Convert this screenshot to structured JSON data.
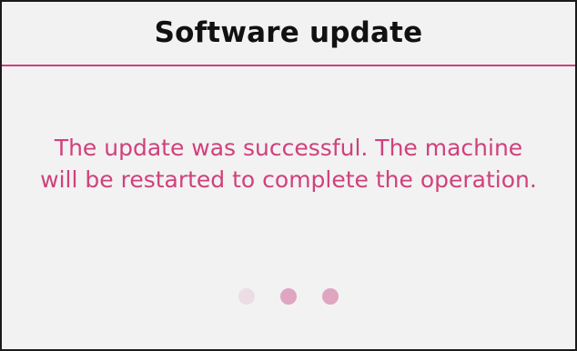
{
  "header": {
    "title": "Software update"
  },
  "main": {
    "message": "The update was successful. The machine will be restarted to complete the operation."
  },
  "progress": {
    "active_index": 2,
    "dot_count": 3,
    "dot_colors": [
      "#ecdde5",
      "#dfa5c1",
      "#dfa5c1"
    ]
  },
  "colors": {
    "accent": "#d0417c",
    "background": "#f2f2f2",
    "title_text": "#111111"
  }
}
